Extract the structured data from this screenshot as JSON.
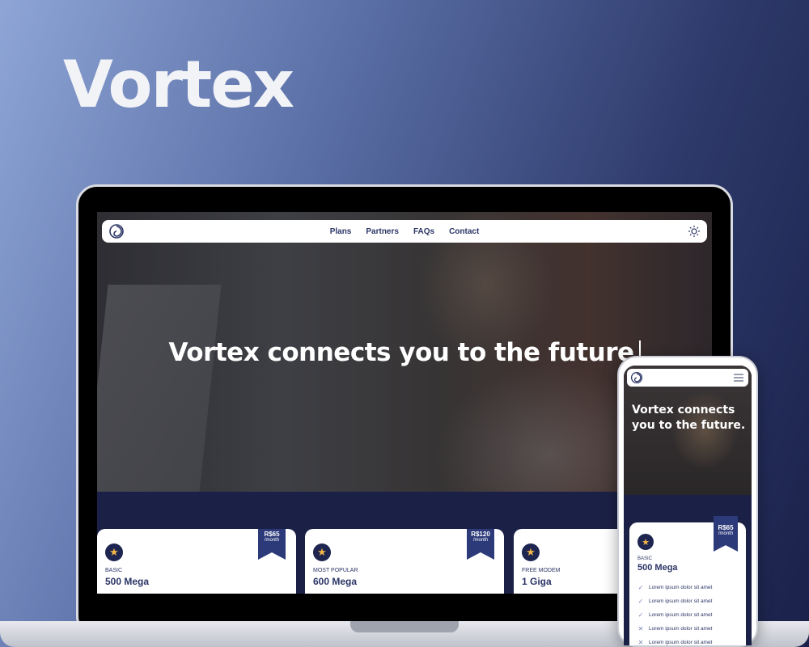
{
  "brand": {
    "title": "Vortex"
  },
  "desktop": {
    "nav": {
      "links": [
        "Plans",
        "Partners",
        "FAQs",
        "Contact"
      ]
    },
    "hero": {
      "title": "Vortex connects you to the future"
    },
    "cards": [
      {
        "kind": "BASIC",
        "speed": "500 Mega",
        "price": "R$65",
        "per": "/month"
      },
      {
        "kind": "MOST POPULAR",
        "speed": "600 Mega",
        "price": "R$120",
        "per": "/month"
      },
      {
        "kind": "FREE MODEM",
        "speed": "1 Giga",
        "price": "",
        "per": ""
      }
    ]
  },
  "mobile": {
    "hero": {
      "title": "Vortex connects you to the future."
    },
    "card": {
      "kind": "BASIC",
      "speed": "500 Mega",
      "price": "R$65",
      "per": "/month",
      "features": [
        {
          "text": "Lorem ipsum dolor sit amet",
          "mark": "✓"
        },
        {
          "text": "Lorem ipsum dolor sit amet",
          "mark": "✓"
        },
        {
          "text": "Lorem ipsum dolor sit amet",
          "mark": "✓"
        },
        {
          "text": "Lorem ipsum dolor sit amet",
          "mark": "✕"
        },
        {
          "text": "Lorem ipsum dolor sit amet",
          "mark": "✕"
        }
      ]
    }
  },
  "colors": {
    "navy": "#1b2146",
    "accent": "#2c3a7a",
    "star": "#f5b64a"
  }
}
